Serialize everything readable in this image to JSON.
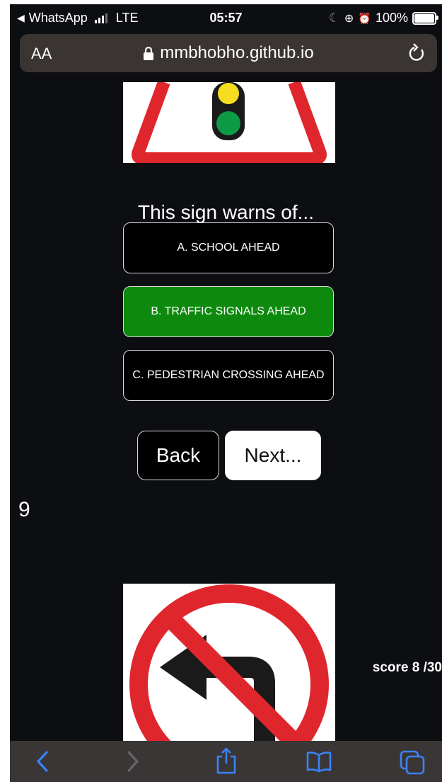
{
  "status_bar": {
    "back_app": "WhatsApp",
    "network": "LTE",
    "time": "05:57",
    "battery": "100%"
  },
  "browser": {
    "text_size_label": "AA",
    "url": "mmbhobho.github.io"
  },
  "quiz": {
    "question": "This sign warns of...",
    "options": [
      {
        "label": "A. SCHOOL AHEAD",
        "state": "default"
      },
      {
        "label": "B. TRAFFIC SIGNALS AHEAD",
        "state": "correct"
      },
      {
        "label": "C. PEDESTRIAN CROSSING AHEAD",
        "state": "default"
      }
    ],
    "back_label": "Back",
    "next_label": "Next...",
    "next_question_number": "9",
    "score": "score 8 /30"
  },
  "icons": {
    "signal": "signal-bars-icon",
    "lock": "lock-icon",
    "reload": "reload-icon",
    "toolbar": [
      "back-icon",
      "forward-icon",
      "share-icon",
      "bookmarks-icon",
      "tabs-icon"
    ]
  },
  "colors": {
    "background": "#0d0e12",
    "correct_option": "#0d8a0d",
    "sign_red": "#e0262d",
    "browser_accent": "#3b82f6"
  }
}
